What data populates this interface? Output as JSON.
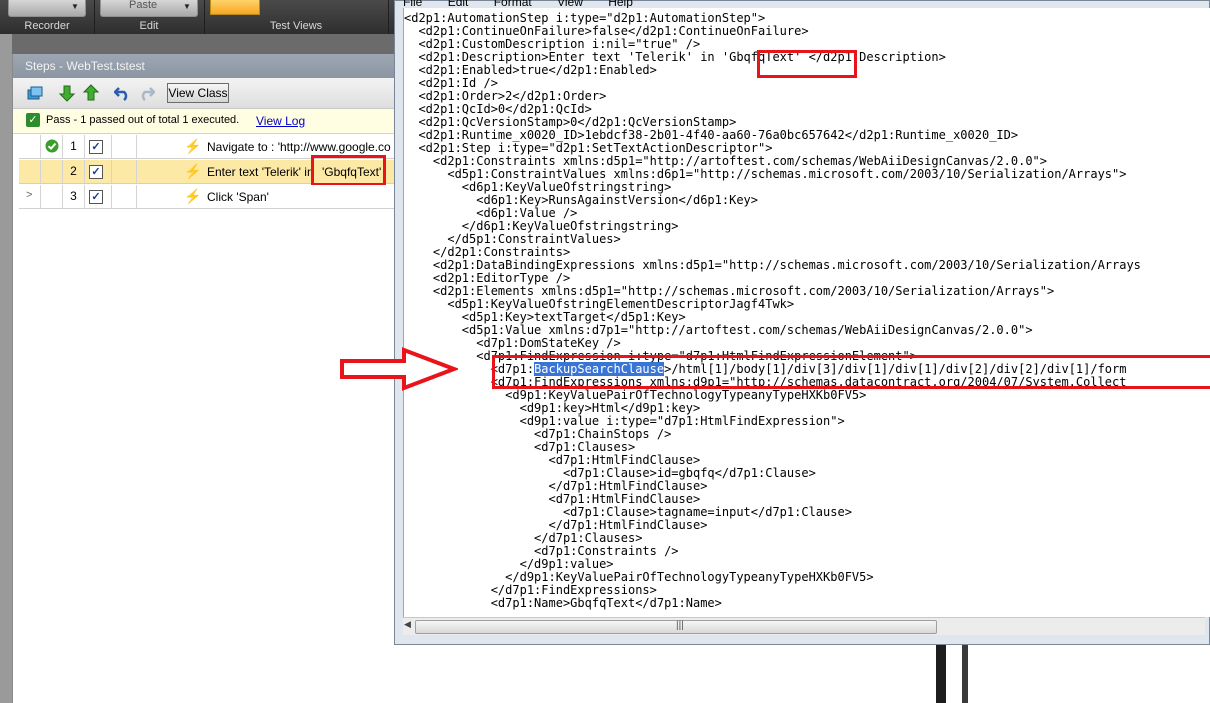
{
  "ribbon": {
    "groups": [
      "Recorder",
      "Edit",
      "Test Views"
    ],
    "paste_label": "Paste"
  },
  "steps": {
    "title": "Steps - WebTest.tstest",
    "toolbar": {
      "view_class_label": "View Class"
    },
    "status": {
      "text": "Pass - 1 passed out of total 1 executed.",
      "view_log": "View Log"
    },
    "rows": [
      {
        "num": "1",
        "desc": "Navigate to : 'http://www.google.co",
        "highlight": ""
      },
      {
        "num": "2",
        "desc": "Enter text 'Telerik' in",
        "highlight": "'GbqfqText'"
      },
      {
        "num": "3",
        "desc": "Click 'Span'",
        "highlight": ""
      }
    ]
  },
  "xml": {
    "menu": [
      "File",
      "Edit",
      "Format",
      "View",
      "Help"
    ],
    "lines": [
      "<d2p1:AutomationStep i:type=\"d2p1:AutomationStep\">",
      "  <d2p1:ContinueOnFailure>false</d2p1:ContinueOnFailure>",
      "  <d2p1:CustomDescription i:nil=\"true\" />",
      "  <d2p1:Description>Enter text 'Telerik' in 'GbqfqText' </d2p1:Description>",
      "  <d2p1:Enabled>true</d2p1:Enabled>",
      "  <d2p1:Id />",
      "  <d2p1:Order>2</d2p1:Order>",
      "  <d2p1:QcId>0</d2p1:QcId>",
      "  <d2p1:QcVersionStamp>0</d2p1:QcVersionStamp>",
      "  <d2p1:Runtime_x0020_ID>1ebdcf38-2b01-4f40-aa60-76a0bc657642</d2p1:Runtime_x0020_ID>",
      "  <d2p1:Step i:type=\"d2p1:SetTextActionDescriptor\">",
      "    <d2p1:Constraints xmlns:d5p1=\"http://artoftest.com/schemas/WebAiiDesignCanvas/2.0.0\">",
      "      <d5p1:ConstraintValues xmlns:d6p1=\"http://schemas.microsoft.com/2003/10/Serialization/Arrays\">",
      "        <d6p1:KeyValueOfstringstring>",
      "          <d6p1:Key>RunsAgainstVersion</d6p1:Key>",
      "          <d6p1:Value />",
      "        </d6p1:KeyValueOfstringstring>",
      "      </d5p1:ConstraintValues>",
      "    </d2p1:Constraints>",
      "    <d2p1:DataBindingExpressions xmlns:d5p1=\"http://schemas.microsoft.com/2003/10/Serialization/Arrays",
      "    <d2p1:EditorType />",
      "    <d2p1:Elements xmlns:d5p1=\"http://schemas.microsoft.com/2003/10/Serialization/Arrays\">",
      "      <d5p1:KeyValueOfstringElementDescriptorJagf4Twk>",
      "        <d5p1:Key>textTarget</d5p1:Key>",
      "        <d5p1:Value xmlns:d7p1=\"http://artoftest.com/schemas/WebAiiDesignCanvas/2.0.0\">",
      "          <d7p1:DomStateKey />",
      "          <d7p1:FindExpression i:type=\"d7p1:HtmlFindExpressionElement\">",
      "            <d7p1:",
      "            <d7p1:FindExpressions xmlns:d9p1=\"http://schemas.datacontract.org/2004/07/System.Collect",
      "              <d9p1:KeyValuePairOfTechnologyTypeanyTypeHXKb0FV5>",
      "                <d9p1:key>Html</d9p1:key>",
      "                <d9p1:value i:type=\"d7p1:HtmlFindExpression\">",
      "                  <d7p1:ChainStops />",
      "                  <d7p1:Clauses>",
      "                    <d7p1:HtmlFindClause>",
      "                      <d7p1:Clause>id=gbqfq</d7p1:Clause>",
      "                    </d7p1:HtmlFindClause>",
      "                    <d7p1:HtmlFindClause>",
      "                      <d7p1:Clause>tagname=input</d7p1:Clause>",
      "                    </d7p1:HtmlFindClause>",
      "                  </d7p1:Clauses>",
      "                  <d7p1:Constraints />",
      "                </d9p1:value>",
      "              </d9p1:KeyValuePairOfTechnologyTypeanyTypeHXKb0FV5>",
      "            </d7p1:FindExpressions>",
      "            <d7p1:Name>GbqfqText</d7p1:Name>"
    ],
    "backup_highlight": "BackupSearchClause",
    "backup_rest": ">/html[1]/body[1]/div[3]/div[1]/div[1]/div[2]/div[2]/div[1]/form"
  }
}
